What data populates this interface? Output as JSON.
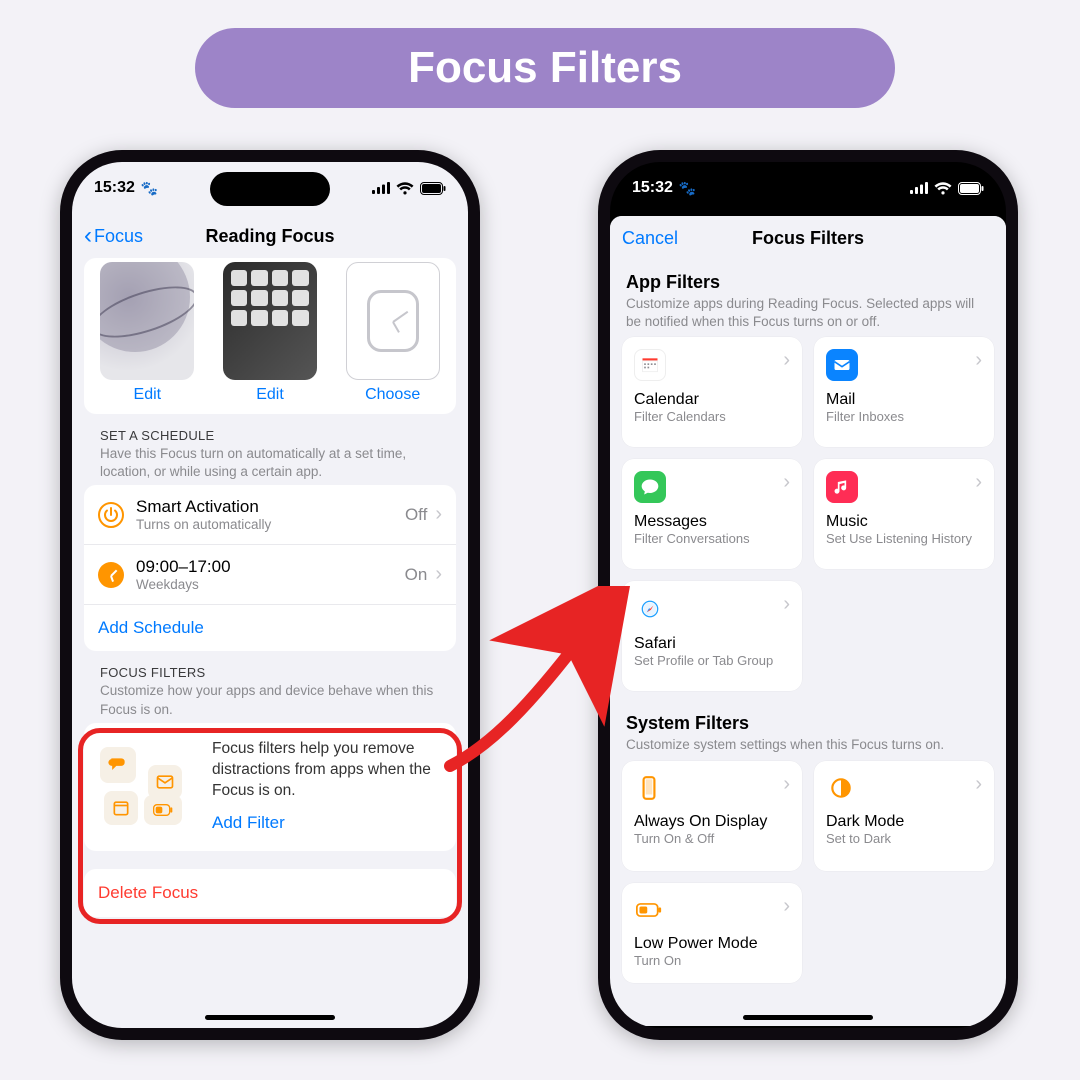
{
  "banner": "Focus Filters",
  "status": {
    "time": "15:32",
    "paw": "🐾"
  },
  "left": {
    "back": "Focus",
    "title": "Reading Focus",
    "thumbs": {
      "edit1": "Edit",
      "edit2": "Edit",
      "choose": "Choose"
    },
    "schedule": {
      "head": "SET A SCHEDULE",
      "sub": "Have this Focus turn on automatically at a set time, location, or while using a certain app.",
      "smart_t": "Smart Activation",
      "smart_s": "Turns on automatically",
      "smart_v": "Off",
      "time_t": "09:00–17:00",
      "time_s": "Weekdays",
      "time_v": "On",
      "add": "Add Schedule"
    },
    "filters": {
      "head": "FOCUS FILTERS",
      "sub": "Customize how your apps and device behave when this Focus is on.",
      "desc": "Focus filters help you remove distractions from apps when the Focus is on.",
      "add": "Add Filter"
    },
    "delete": "Delete Focus"
  },
  "right": {
    "cancel": "Cancel",
    "title": "Focus Filters",
    "app_head": "App Filters",
    "app_sub": "Customize apps during Reading Focus. Selected apps will be notified when this Focus turns on or off.",
    "tiles": {
      "cal_t": "Calendar",
      "cal_s": "Filter Calendars",
      "mail_t": "Mail",
      "mail_s": "Filter Inboxes",
      "msg_t": "Messages",
      "msg_s": "Filter Conversations",
      "music_t": "Music",
      "music_s": "Set Use Listening History",
      "safari_t": "Safari",
      "safari_s": "Set Profile or Tab Group"
    },
    "sys_head": "System Filters",
    "sys_sub": "Customize system settings when this Focus turns on.",
    "sys": {
      "aod_t": "Always On Display",
      "aod_s": "Turn On & Off",
      "dark_t": "Dark Mode",
      "dark_s": "Set to Dark",
      "lpm_t": "Low Power Mode",
      "lpm_s": "Turn On"
    }
  }
}
